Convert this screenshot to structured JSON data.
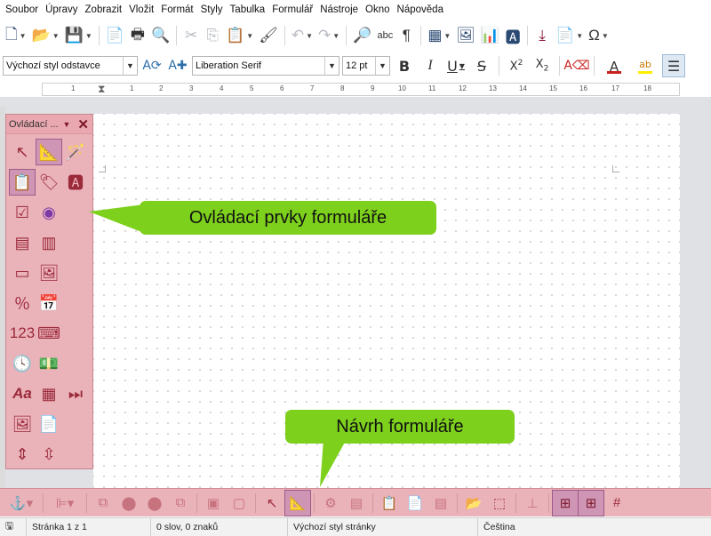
{
  "menubar": [
    "Soubor",
    "Úpravy",
    "Zobrazit",
    "Vložit",
    "Formát",
    "Styly",
    "Tabulka",
    "Formulář",
    "Nástroje",
    "Okno",
    "Nápověda"
  ],
  "format_toolbar": {
    "paragraph_style": "Výchozí styl odstavce",
    "font_name": "Liberation Serif",
    "font_size": "12 pt",
    "font_color": "#c9211e",
    "highlight_color": "#ffee00"
  },
  "ruler": {
    "labels": [
      "1",
      "1",
      "2",
      "3",
      "4",
      "5",
      "6",
      "7",
      "8",
      "9",
      "10",
      "11",
      "12",
      "13",
      "14",
      "15",
      "16",
      "17",
      "18"
    ]
  },
  "form_controls_panel": {
    "title": "Ovládací ...",
    "numeric_field_label": "123",
    "formatted_field_label": "Aa"
  },
  "callouts": {
    "form_controls": "Ovládací prvky formuláře",
    "form_design": "Návrh formuláře"
  },
  "statusbar": {
    "page": "Stránka 1 z 1",
    "words": "0 slov, 0 znaků",
    "page_style": "Výchozí styl stránky",
    "language": "Čeština"
  }
}
